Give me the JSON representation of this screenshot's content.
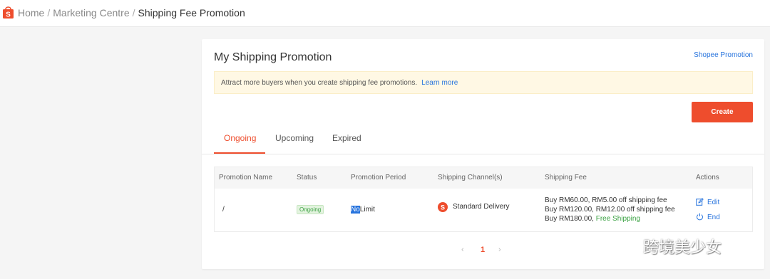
{
  "breadcrumb": {
    "home": "Home",
    "separator": "/",
    "marketing": "Marketing Centre",
    "current": "Shipping Fee Promotion"
  },
  "panel": {
    "title": "My Shipping Promotion",
    "shopee_link": "Shopee Promotion",
    "banner_text": "Attract more buyers when you create shipping fee promotions.",
    "banner_link": "Learn more",
    "create_label": "Create"
  },
  "tabs": [
    {
      "label": "Ongoing",
      "active": true
    },
    {
      "label": "Upcoming",
      "active": false
    },
    {
      "label": "Expired",
      "active": false
    }
  ],
  "table": {
    "headers": [
      "Promotion Name",
      "Status",
      "Promotion Period",
      "Shipping Channel(s)",
      "Shipping Fee",
      "Actions"
    ],
    "row": {
      "name": "/",
      "status": "Ongoing",
      "period_highlight": "No",
      "period_rest": "Limit",
      "channel": "Standard Delivery",
      "channel_icon_letter": "S",
      "fee_lines": [
        "Buy RM60.00, RM5.00 off shipping fee",
        "Buy RM120.00, RM12.00 off shipping fee"
      ],
      "fee_last_prefix": "Buy RM180.00,",
      "fee_last_free": "Free Shipping",
      "edit_label": "Edit",
      "end_label": "End"
    }
  },
  "pagination": {
    "prev": "‹",
    "current_page": "1",
    "next": "›"
  },
  "watermark": {
    "text": "跨境美少女"
  },
  "colors": {
    "brand": "#ee4d2d",
    "link": "#2673dd",
    "success": "#3aa142",
    "banner_bg": "#fff8e4"
  },
  "icons": [
    "shopee-logo-icon",
    "shopee-channel-icon",
    "edit-icon",
    "power-icon",
    "chevron-left-icon",
    "chevron-right-icon",
    "wechat-icon"
  ]
}
